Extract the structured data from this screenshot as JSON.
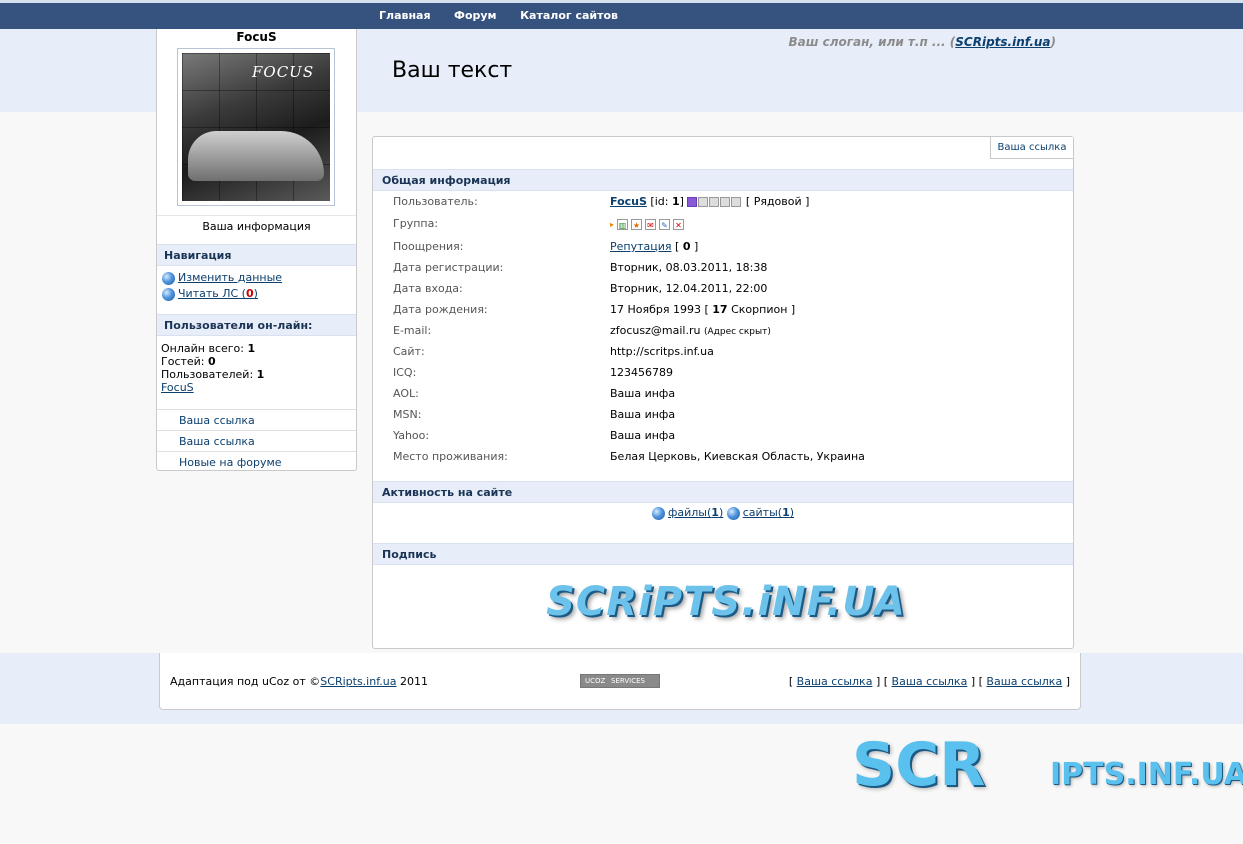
{
  "nav": {
    "items": [
      "Главная",
      "Форум",
      "Каталог сайтов"
    ]
  },
  "header": {
    "slogan_prefix": "Ваш слоган, или т.п ... (",
    "slogan_link": "SCRipts.inf.ua",
    "slogan_suffix": ")",
    "site_title": "Ваш текст"
  },
  "sidebar": {
    "username": "FocuS",
    "avatar_text": "FOCUS",
    "info_label": "Ваша информация",
    "nav_header": "Навигация",
    "nav_items": [
      {
        "label": "Изменить данные",
        "count": ""
      },
      {
        "label": "Читать ЛС (",
        "count": "0",
        "suffix": ")"
      }
    ],
    "online_header": "Пользователи он-лайн:",
    "online": {
      "total_label": "Онлайн всего:",
      "total": "1",
      "guests_label": "Гостей:",
      "guests": "0",
      "users_label": "Пользователей:",
      "users": "1",
      "user_link": "FocuS"
    },
    "links": [
      "Ваша ссылка",
      "Ваша ссылка",
      "Новые на форуме"
    ]
  },
  "main": {
    "link_button": "Ваша ссылка",
    "general_header": "Общая информация",
    "rows": [
      {
        "label": "Пользователь:",
        "value": ""
      },
      {
        "label": "Группа:",
        "value": ""
      },
      {
        "label": "Поощрения:",
        "value": ""
      },
      {
        "label": "Дата регистрации:",
        "value": "Вторник, 08.03.2011, 18:38"
      },
      {
        "label": "Дата входа:",
        "value": "Вторник, 12.04.2011, 22:00"
      },
      {
        "label": "Дата рождения:",
        "value": ""
      },
      {
        "label": "E-mail:",
        "value": "zfocusz@mail.ru"
      },
      {
        "label": "Сайт:",
        "value": "http://scritps.inf.ua"
      },
      {
        "label": "ICQ:",
        "value": "123456789"
      },
      {
        "label": "AOL:",
        "value": "Ваша инфа"
      },
      {
        "label": "MSN:",
        "value": "Ваша инфа"
      },
      {
        "label": "Yahoo:",
        "value": "Ваша инфа"
      },
      {
        "label": "Место проживания:",
        "value": "Белая Церковь, Киевская Область, Украина"
      }
    ],
    "user": {
      "name": "FocuS",
      "id_prefix": "[id: ",
      "id": "1",
      "id_suffix": "]",
      "rank": "[ Рядовой ]",
      "rank_stars_filled": 1,
      "rank_stars_total": 5
    },
    "reputation": {
      "link": "Репутация",
      "open": " [ ",
      "value": "0",
      "close": " ]"
    },
    "birthday": {
      "date": "17 Ноября 1993 [ ",
      "age": "17",
      "sign": " Скорпион ]"
    },
    "email_note": "(Адрес скрыт)",
    "activity_header": "Активность на сайте",
    "activity": [
      {
        "label": "файлы(",
        "count": "1",
        "suffix": ")"
      },
      {
        "label": "сайты(",
        "count": "1",
        "suffix": ")"
      }
    ],
    "signature_header": "Подпись",
    "signature_text": "SCRiPTS.iNF.UA"
  },
  "footer": {
    "left_prefix": "Адаптация под uCoz от ©",
    "left_link": "SCRipts.inf.ua",
    "left_suffix": " 2011",
    "badge_left": "UCOZ",
    "badge_right": "SERVICES",
    "links": [
      "Ваша ссылка",
      "Ваша ссылка",
      "Ваша ссылка"
    ]
  },
  "brand": {
    "big": "SCR",
    "small": "IPTS.INF.UA"
  },
  "colors": {
    "topbar": "#36537f",
    "band": "#e8eef9",
    "link": "#0b3f6e"
  }
}
